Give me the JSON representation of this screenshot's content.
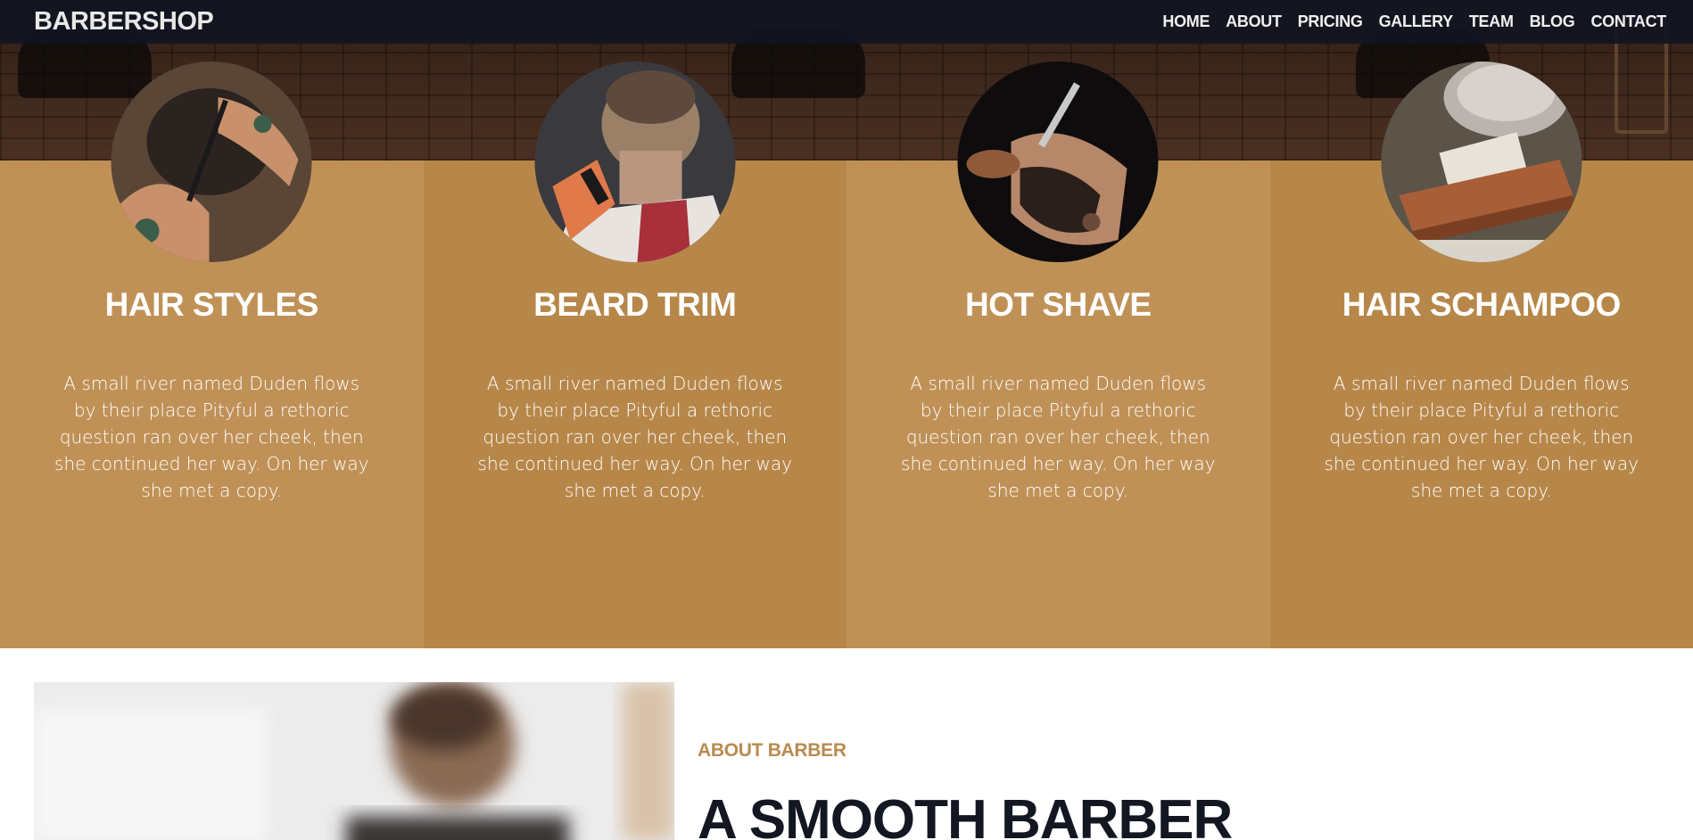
{
  "navbar": {
    "brand": "BARBERSHOP",
    "links": [
      "HOME",
      "ABOUT",
      "PRICING",
      "GALLERY",
      "TEAM",
      "BLOG",
      "CONTACT"
    ]
  },
  "services": [
    {
      "title": "HAIR STYLES",
      "text": "A small river named Duden flows by their place Pityful a rethoric question ran over her cheek, then she continued her way. On her way she met a copy."
    },
    {
      "title": "BEARD TRIM",
      "text": "A small river named Duden flows by their place Pityful a rethoric question ran over her cheek, then she continued her way. On her way she met a copy."
    },
    {
      "title": "HOT SHAVE",
      "text": "A small river named Duden flows by their place Pityful a rethoric question ran over her cheek, then she continued her way. On her way she met a copy."
    },
    {
      "title": "HAIR SCHAMPOO",
      "text": "A small river named Duden flows by their place Pityful a rethoric question ran over her cheek, then she continued her way. On her way she met a copy."
    }
  ],
  "about": {
    "eyebrow": "ABOUT BARBER",
    "heading": "A SMOOTH BARBER"
  },
  "colors": {
    "navbar_bg": "#111521",
    "accent": "#b98a50",
    "column_light": "#c09157",
    "column_dark": "#b7874a",
    "heading_dark": "#131722"
  }
}
